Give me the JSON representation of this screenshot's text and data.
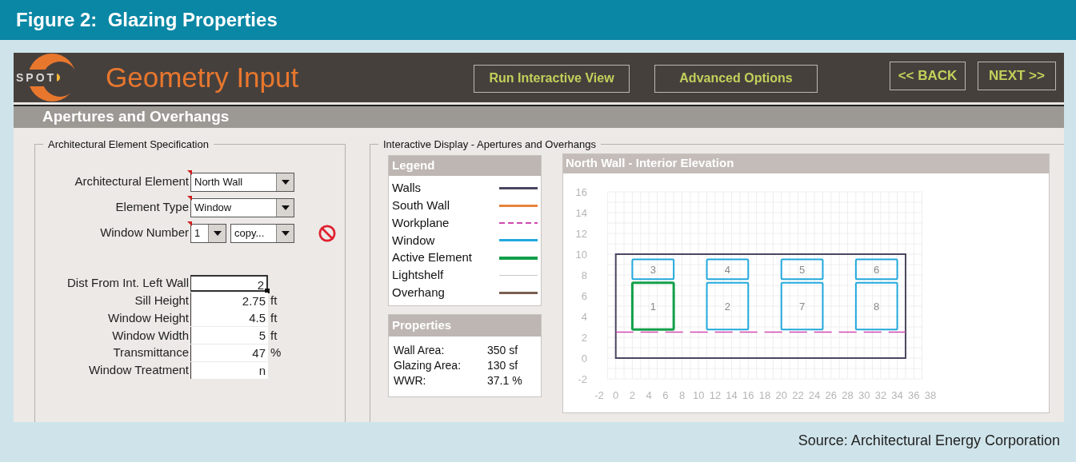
{
  "figure": {
    "title": "Figure 2:  Glazing Properties",
    "source": "Source: Architectural Energy Corporation"
  },
  "app": {
    "logo": "SPOT",
    "title": "Geometry Input"
  },
  "buttons": [
    {
      "label": "Run Interactive View",
      "kind": "action"
    },
    {
      "label": "Advanced Options",
      "kind": "action"
    },
    {
      "label": "<< BACK",
      "kind": "nav"
    },
    {
      "label": "NEXT >>",
      "kind": "nav"
    }
  ],
  "section_title": "Apertures and Overhangs",
  "spec": {
    "title": "Architectural Element Specification",
    "selects": [
      {
        "label": "Architectural Element",
        "values": [
          "North Wall"
        ],
        "delete_icon": false
      },
      {
        "label": "Element Type",
        "values": [
          "Window"
        ],
        "delete_icon": false
      },
      {
        "label": "Window Number",
        "values": [
          "1",
          "copy..."
        ],
        "delete_icon": true
      }
    ],
    "fields": [
      {
        "label": "Dist From Int. Left Wall",
        "value": "2",
        "selected": true
      },
      {
        "label": "Sill Height",
        "value": "2.75",
        "unit": "ft",
        "selected": false
      },
      {
        "label": "Window Height",
        "value": "4.5",
        "unit": "ft",
        "selected": false
      },
      {
        "label": "Window Width",
        "value": "5",
        "unit": "ft",
        "selected": false
      },
      {
        "label": "Transmittance",
        "value": "47",
        "unit": "%",
        "selected": false
      },
      {
        "label": "Window Treatment",
        "value": "n",
        "selected": false
      }
    ]
  },
  "display": {
    "title": "Interactive Display - Apertures and Overhangs",
    "legend": {
      "title": "Legend",
      "items": [
        {
          "label": "Walls",
          "color": "#4a4660",
          "kind": "solid"
        },
        {
          "label": "South Wall",
          "color": "#e8823a",
          "kind": "solid"
        },
        {
          "label": "Workplane",
          "color": "#d048b0",
          "kind": "dashed"
        },
        {
          "label": "Window",
          "color": "#22a8dc",
          "kind": "solid"
        },
        {
          "label": "Active Element",
          "color": "#12a04a",
          "kind": "thick"
        },
        {
          "label": "Lightshelf",
          "color": "#c8c8c8",
          "kind": "thin"
        },
        {
          "label": "Overhang",
          "color": "#7a6050",
          "kind": "solid"
        }
      ]
    },
    "properties": {
      "title": "Properties",
      "rows": [
        {
          "label": "Wall Area:",
          "value": "350 sf"
        },
        {
          "label": "Glazing Area:",
          "value": "130 sf"
        },
        {
          "label": "WWR:",
          "value": "37.1 %"
        }
      ]
    },
    "chart": {
      "title": "North Wall - Interior Elevation",
      "y_ticks": [
        "16",
        "14",
        "12",
        "10",
        "8",
        "6",
        "4",
        "2",
        "0",
        "-2"
      ],
      "window_rows": [
        {
          "windows": [
            {
              "label": "3",
              "active": false
            },
            {
              "label": "4",
              "active": false
            },
            {
              "label": "5",
              "active": false
            },
            {
              "label": "6",
              "active": false
            }
          ]
        },
        {
          "windows": [
            {
              "label": "1",
              "active": true
            },
            {
              "label": "2",
              "active": false
            },
            {
              "label": "7",
              "active": false
            },
            {
              "label": "8",
              "active": false
            }
          ]
        }
      ],
      "x_ticks": [
        "-2",
        "0",
        "2",
        "4",
        "6",
        "8",
        "10",
        "12",
        "14",
        "16",
        "18",
        "20",
        "22",
        "24",
        "26",
        "28",
        "30",
        "32",
        "34",
        "36",
        "38"
      ]
    }
  }
}
